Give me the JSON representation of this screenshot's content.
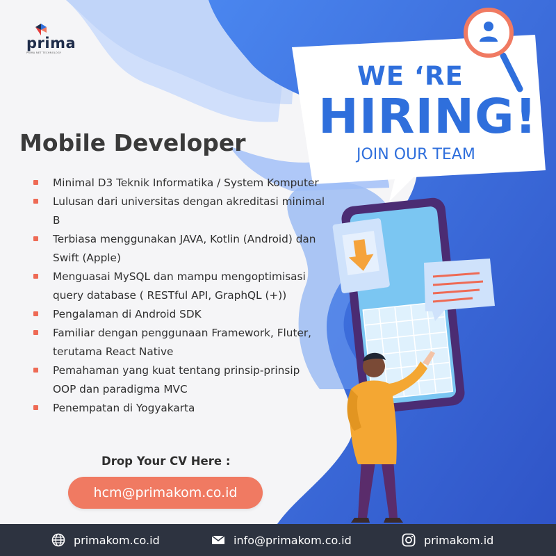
{
  "brand": {
    "name": "prima",
    "tagline": "PRIMA NET TECHNOLOGY"
  },
  "headline": {
    "were": "WE ‘RE",
    "hiring": "HIRING!",
    "join": "JOIN OUR TEAM"
  },
  "job": {
    "title": "Mobile Developer",
    "requirements": [
      "Minimal D3 Teknik Informatika / System Komputer",
      "Lulusan dari universitas dengan akreditasi minimal B",
      "Terbiasa menggunakan JAVA, Kotlin (Android) dan Swift (Apple)",
      "Menguasai MySQL dan mampu mengoptimisasi query database ( RESTful API, GraphQL (+))",
      "Pengalaman di Android SDK",
      "Familiar dengan penggunaan Framework, Fluter, terutama React Native",
      "Pemahaman yang kuat tentang prinsip-prinsip OOP dan paradigma MVC",
      "Penempatan di Yogyakarta"
    ]
  },
  "cta": {
    "label": "Drop Your CV Here :",
    "email": "hcm@primakom.co.id"
  },
  "footer": {
    "website": "primakom.co.id",
    "email": "info@primakom.co.id",
    "instagram": "primakom.id"
  },
  "icons": {
    "website": "globe-icon",
    "email": "envelope-icon",
    "instagram": "instagram-icon",
    "magnifier": "user-search-icon",
    "download": "download-arrow-icon"
  },
  "colors": {
    "accent_blue": "#2f6fdc",
    "bullet_orange": "#ee6a55",
    "button_orange": "#f07a62",
    "footer_dark": "#2d3340"
  }
}
